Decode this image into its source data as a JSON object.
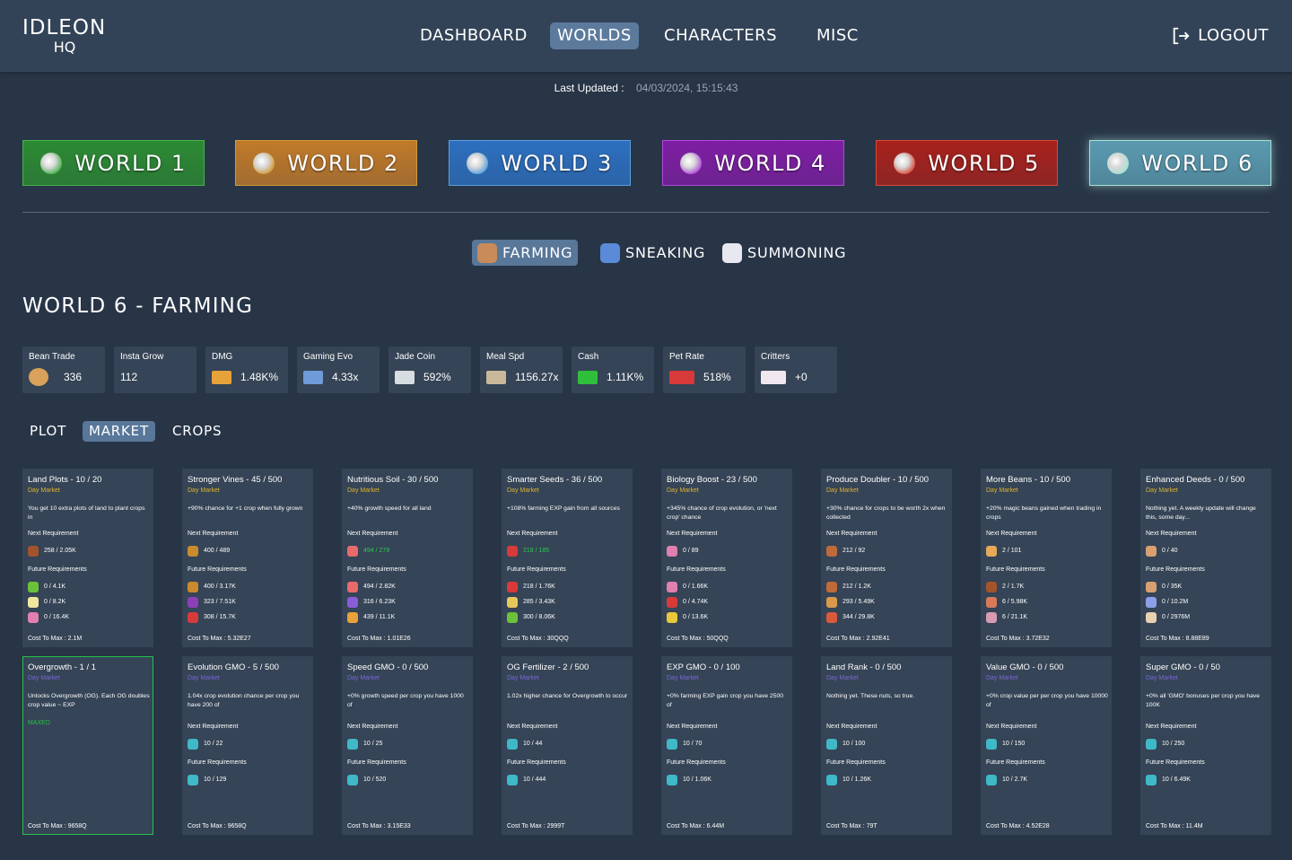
{
  "header": {
    "logo_line1": "IDLEON",
    "logo_line2": "HQ",
    "nav": [
      "DASHBOARD",
      "WORLDS",
      "CHARACTERS",
      "MISC"
    ],
    "nav_active": "WORLDS",
    "logout": "LOGOUT"
  },
  "updated": {
    "label": "Last Updated :",
    "value": "04/03/2024, 15:15:43"
  },
  "worlds": [
    {
      "label": "WORLD 1",
      "bg": "#2c8a33",
      "border": "#46b34c",
      "icon": "world-1-icon"
    },
    {
      "label": "WORLD 2",
      "bg": "#c07a2a",
      "border": "#d29a3a",
      "icon": "world-2-icon"
    },
    {
      "label": "WORLD 3",
      "bg": "#2d6fbf",
      "border": "#5aa1de",
      "icon": "world-3-icon"
    },
    {
      "label": "WORLD 4",
      "bg": "#7e1ea3",
      "border": "#b049d8",
      "icon": "world-4-icon"
    },
    {
      "label": "WORLD 5",
      "bg": "#a7211c",
      "border": "#d84a3a",
      "icon": "world-5-icon"
    },
    {
      "label": "WORLD 6",
      "bg": "#5a9ab0",
      "border": "#a8e0d4",
      "icon": "world-6-icon"
    }
  ],
  "subtabs": [
    {
      "label": "FARMING",
      "icon": "farming-icon",
      "active": true
    },
    {
      "label": "SNEAKING",
      "icon": "sneaking-icon",
      "active": false
    },
    {
      "label": "SUMMONING",
      "icon": "summoning-icon",
      "active": false
    }
  ],
  "page_title": "WORLD 6 - FARMING",
  "stats": [
    {
      "label": "Bean Trade",
      "value": "336",
      "icon": "bean-icon",
      "color": "#d9a15a",
      "iconw": 22
    },
    {
      "label": "Insta Grow",
      "value": "112",
      "icon": "",
      "color": "",
      "iconw": 0
    },
    {
      "label": "DMG",
      "value": "1.48K%",
      "icon": "dmg-bar-icon",
      "color": "#e8a23a",
      "iconw": 22
    },
    {
      "label": "Gaming Evo",
      "value": "4.33x",
      "icon": "gaming-evo-icon",
      "color": "#6f9bd8",
      "iconw": 22
    },
    {
      "label": "Jade Coin",
      "value": "592%",
      "icon": "jade-coin-icon",
      "color": "#d8dde2",
      "iconw": 22
    },
    {
      "label": "Meal Spd",
      "value": "1156.27x",
      "icon": "meal-spd-icon",
      "color": "#c9b99b",
      "iconw": 22
    },
    {
      "label": "Cash",
      "value": "1.11K%",
      "icon": "cash-icon",
      "color": "#2fbf3c",
      "iconw": 22
    },
    {
      "label": "Pet Rate",
      "value": "518%",
      "icon": "pet-rate-icon",
      "color": "#d83a3a",
      "iconw": 28
    },
    {
      "label": "Critters",
      "value": "+0",
      "icon": "critters-icon",
      "color": "#f0e8ee",
      "iconw": 28
    }
  ],
  "tabs": [
    "PLOT",
    "MARKET",
    "CROPS"
  ],
  "tab_active": "MARKET",
  "labels": {
    "next": "Next Requirement",
    "future": "Future Requirements",
    "maxed": "MAXED"
  },
  "cards": [
    {
      "title": "Land Plots - 10 / 20",
      "sub": "Day Market",
      "desc": "You get 10 extra plots of land to plant crops in",
      "next": [
        {
          "v": "258 / 2.05K",
          "c": "#a3542b",
          "icon": "seed-icon"
        }
      ],
      "future": [
        {
          "v": "0 / 4.1K",
          "c": "#6bc23a",
          "icon": "seed-icon"
        },
        {
          "v": "0 / 8.2K",
          "c": "#f0e6a0",
          "icon": "flower-icon"
        },
        {
          "v": "0 / 16.4K",
          "c": "#e07fb0",
          "icon": "flower-icon"
        }
      ],
      "cost": "Cost To Max : 2.1M"
    },
    {
      "title": "Stronger Vines - 45 / 500",
      "sub": "Day Market",
      "desc": "+90% chance for +1 crop when fully grown",
      "next": [
        {
          "v": "400 / 489",
          "c": "#c98b2c",
          "icon": "pineapple-icon"
        }
      ],
      "future": [
        {
          "v": "400 / 3.17K",
          "c": "#c98b2c",
          "icon": "pineapple-icon"
        },
        {
          "v": "323 / 7.51K",
          "c": "#8c3fb8",
          "icon": "berry-icon"
        },
        {
          "v": "308 / 15.7K",
          "c": "#d83a3a",
          "icon": "berry-icon"
        }
      ],
      "cost": "Cost To Max : 5.32E27"
    },
    {
      "title": "Nutritious Soil - 30 / 500",
      "sub": "Day Market",
      "desc": "+40% growth speed for all land",
      "next": [
        {
          "v": "494 / 279",
          "c": "#e86a6a",
          "icon": "fruit-icon",
          "g": true
        }
      ],
      "future": [
        {
          "v": "494 / 2.82K",
          "c": "#e86a6a",
          "icon": "fruit-icon"
        },
        {
          "v": "316 / 6.23K",
          "c": "#8a5cd8",
          "icon": "grape-icon"
        },
        {
          "v": "439 / 11.1K",
          "c": "#e8a23a",
          "icon": "gourd-icon"
        }
      ],
      "cost": "Cost To Max : 1.01E26"
    },
    {
      "title": "Smarter Seeds - 36 / 500",
      "sub": "Day Market",
      "desc": "+108% farming EXP gain from all sources",
      "next": [
        {
          "v": "218 / 185",
          "c": "#d83a3a",
          "icon": "pepper-icon",
          "g": true
        }
      ],
      "future": [
        {
          "v": "218 / 1.76K",
          "c": "#d83a3a",
          "icon": "pepper-icon"
        },
        {
          "v": "285 / 3.43K",
          "c": "#e8c85a",
          "icon": "gourd-icon"
        },
        {
          "v": "300 / 8.06K",
          "c": "#6bc23a",
          "icon": "pepper-icon"
        }
      ],
      "cost": "Cost To Max : 30QQQ"
    },
    {
      "title": "Biology Boost - 23 / 500",
      "sub": "Day Market",
      "desc": "+345% chance of crop evolution, or 'next crop' chance",
      "next": [
        {
          "v": "0 / 89",
          "c": "#e07fb0",
          "icon": "flower-icon"
        }
      ],
      "future": [
        {
          "v": "0 / 1.66K",
          "c": "#e07fb0",
          "icon": "flower-icon"
        },
        {
          "v": "0 / 4.74K",
          "c": "#d83a3a",
          "icon": "flower-icon"
        },
        {
          "v": "0 / 13.6K",
          "c": "#e8c83a",
          "icon": "sunflower-icon"
        }
      ],
      "cost": "Cost To Max : 50QQQ"
    },
    {
      "title": "Produce Doubler - 10 / 500",
      "sub": "Day Market",
      "desc": "+30% chance for crops to be worth 2x when collected",
      "next": [
        {
          "v": "212 / 92",
          "c": "#c06a3a",
          "icon": "carrot-icon"
        }
      ],
      "future": [
        {
          "v": "212 / 1.2K",
          "c": "#c06a3a",
          "icon": "carrot-icon"
        },
        {
          "v": "293 / 5.49K",
          "c": "#d89a4a",
          "icon": "melon-icon"
        },
        {
          "v": "344 / 29.8K",
          "c": "#d85a3a",
          "icon": "melon-icon"
        }
      ],
      "cost": "Cost To Max : 2.92E41"
    },
    {
      "title": "More Beans - 10 / 500",
      "sub": "Day Market",
      "desc": "+20% magic beans gained when trading in crops",
      "next": [
        {
          "v": "2 / 101",
          "c": "#e8a85a",
          "icon": "bean-icon"
        }
      ],
      "future": [
        {
          "v": "2 / 1.7K",
          "c": "#a3542b",
          "icon": "mushroom-icon"
        },
        {
          "v": "6 / 5.98K",
          "c": "#d87a5a",
          "icon": "mushroom-icon"
        },
        {
          "v": "6 / 21.1K",
          "c": "#d89ab0",
          "icon": "mushroom-icon"
        }
      ],
      "cost": "Cost To Max : 3.72E32"
    },
    {
      "title": "Enhanced Deeds - 0 / 500",
      "sub": "Day Market",
      "desc": "Nothing yet. A weekly update will change this, some day...",
      "next": [
        {
          "v": "0 / 40",
          "c": "#d8a070",
          "icon": "mushroom-icon"
        }
      ],
      "future": [
        {
          "v": "0 / 35K",
          "c": "#d8a070",
          "icon": "mushroom-icon"
        },
        {
          "v": "0 / 10.2M",
          "c": "#8aa0e8",
          "icon": "mushroom-icon"
        },
        {
          "v": "0 / 2976M",
          "c": "#e8d0b0",
          "icon": "mushroom-icon"
        }
      ],
      "cost": "Cost To Max : 8.88E89"
    },
    {
      "title": "Overgrowth - 1 / 1",
      "sub": "Day Market",
      "purple": true,
      "maxed": true,
      "desc": "Unlocks Overgrowth (OG). Each OG doubles crop value ~ EXP",
      "next": [],
      "future": [],
      "cost": "Cost To Max : 9658Q"
    },
    {
      "title": "Evolution GMO - 5 / 500",
      "sub": "Day Market",
      "purple": true,
      "desc": "1.04x crop evolution chance per crop you have 200 of",
      "next": [
        {
          "v": "10 / 22",
          "c": "#3fb8c8",
          "icon": "gmo-icon"
        }
      ],
      "future": [
        {
          "v": "10 / 129",
          "c": "#3fb8c8",
          "icon": "gmo-icon"
        }
      ],
      "cost": "Cost To Max : 9658Q"
    },
    {
      "title": "Speed GMO - 0 / 500",
      "sub": "Day Market",
      "purple": true,
      "desc": "+0% growth speed per crop you have 1000 of",
      "next": [
        {
          "v": "10 / 25",
          "c": "#3fb8c8",
          "icon": "gmo-icon"
        }
      ],
      "future": [
        {
          "v": "10 / 520",
          "c": "#3fb8c8",
          "icon": "gmo-icon"
        }
      ],
      "cost": "Cost To Max : 3.15E33"
    },
    {
      "title": "OG Fertilizer - 2 / 500",
      "sub": "Day Market",
      "purple": true,
      "desc": "1.02x higher chance for Overgrowth to occur",
      "next": [
        {
          "v": "10 / 44",
          "c": "#3fb8c8",
          "icon": "gmo-icon"
        }
      ],
      "future": [
        {
          "v": "10 / 444",
          "c": "#3fb8c8",
          "icon": "gmo-icon"
        }
      ],
      "cost": "Cost To Max : 2999T"
    },
    {
      "title": "EXP GMO - 0 / 100",
      "sub": "Day Market",
      "purple": true,
      "desc": "+0% farming EXP gain crop you have 2500 of",
      "next": [
        {
          "v": "10 / 70",
          "c": "#3fb8c8",
          "icon": "gmo-icon"
        }
      ],
      "future": [
        {
          "v": "10 / 1.06K",
          "c": "#3fb8c8",
          "icon": "gmo-icon"
        }
      ],
      "cost": "Cost To Max : 6.44M"
    },
    {
      "title": "Land Rank - 0 / 500",
      "sub": "Day Market",
      "purple": true,
      "desc": "Nothing yet. These nuts, so true.",
      "next": [
        {
          "v": "10 / 100",
          "c": "#3fb8c8",
          "icon": "gmo-icon"
        }
      ],
      "future": [
        {
          "v": "10 / 1.26K",
          "c": "#3fb8c8",
          "icon": "gmo-icon"
        }
      ],
      "cost": "Cost To Max : 79T"
    },
    {
      "title": "Value GMO - 0 / 500",
      "sub": "Day Market",
      "purple": true,
      "desc": "+0% crop value per per crop you have 10000 of",
      "next": [
        {
          "v": "10 / 150",
          "c": "#3fb8c8",
          "icon": "gmo-icon"
        }
      ],
      "future": [
        {
          "v": "10 / 2.7K",
          "c": "#3fb8c8",
          "icon": "gmo-icon"
        }
      ],
      "cost": "Cost To Max : 4.52E28"
    },
    {
      "title": "Super GMO - 0 / 50",
      "sub": "Day Market",
      "purple": true,
      "desc": "+0% all 'GMO' bonuses per crop you have 100K",
      "next": [
        {
          "v": "10 / 250",
          "c": "#3fb8c8",
          "icon": "gmo-icon"
        }
      ],
      "future": [
        {
          "v": "10 / 6.49K",
          "c": "#3fb8c8",
          "icon": "gmo-icon"
        }
      ],
      "cost": "Cost To Max : 11.4M"
    }
  ]
}
